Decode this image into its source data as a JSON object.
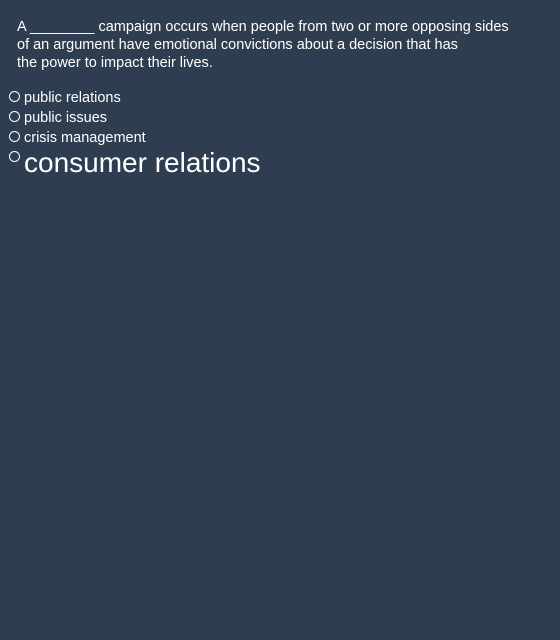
{
  "question": {
    "line_1": "A ________ campaign occurs when people from two or more opposing sides",
    "line_2": "of an argument have emotional convictions about a decision that has",
    "line_3": "the power to impact their lives."
  },
  "options": [
    {
      "label": "public relations",
      "selected": false
    },
    {
      "label": "public issues",
      "selected": false
    },
    {
      "label": "crisis management",
      "selected": false
    },
    {
      "label": "consumer relations",
      "selected": false
    }
  ],
  "colors": {
    "background": "#2e3e50",
    "text": "#ffffff"
  }
}
